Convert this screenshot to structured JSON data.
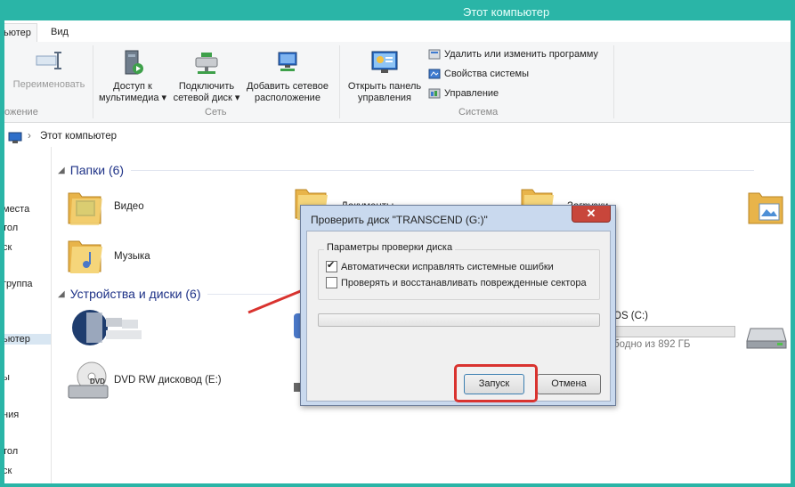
{
  "window": {
    "title": "Этот компьютер"
  },
  "tabs": [
    {
      "label": "ьютер",
      "active": true
    },
    {
      "label": "Вид",
      "active": false
    }
  ],
  "ribbon": {
    "rename_label": "Переименовать",
    "group1_label": "ожение",
    "network_buttons": [
      {
        "label": "Доступ к мультимедиа ▾"
      },
      {
        "label": "Подключить сетевой диск ▾"
      },
      {
        "label": "Добавить сетевое расположение"
      }
    ],
    "network_group_label": "Сеть",
    "control_panel_label": "Открыть панель управления",
    "system_items": [
      {
        "label": "Удалить или изменить программу"
      },
      {
        "label": "Свойства системы"
      },
      {
        "label": "Управление"
      }
    ],
    "system_group_label": "Система"
  },
  "address": {
    "separator": "›",
    "path": "Этот компьютер"
  },
  "nav": {
    "items": [
      "места",
      "тол",
      "ск",
      "группа",
      "ьютер",
      "ы",
      "ния",
      "тол",
      "ск"
    ],
    "selected_index": 4
  },
  "folders_section": {
    "title": "Папки (6)"
  },
  "folders": [
    "Видео",
    "Документы",
    "Загрузки",
    "Музыка"
  ],
  "devices_section": {
    "title": "Устройства и диски (6)"
  },
  "devices": {
    "dvd_label": "DVD RW дисковод (E:)",
    "dvd_badge": "DVD",
    "os_label": "OS (C:)",
    "os_free": "бодно из 892 ГБ"
  },
  "dialog": {
    "title": "Проверить диск \"TRANSCEND (G:)\"",
    "close_glyph": "✕",
    "group_label": "Параметры проверки диска",
    "options": [
      {
        "label": "Автоматически исправлять системные ошибки",
        "checked": true
      },
      {
        "label": "Проверять и восстанавливать поврежденные сектора",
        "checked": false
      }
    ],
    "progress": 0,
    "start_label": "Запуск",
    "cancel_label": "Отмена"
  },
  "colors": {
    "frame": "#2ab5a7",
    "highlight": "#d9332f",
    "section_title": "#1e3287"
  }
}
